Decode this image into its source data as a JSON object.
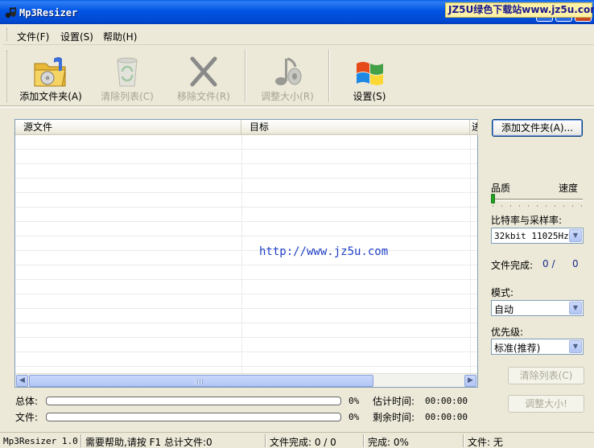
{
  "window": {
    "title": "Mp3Resizer",
    "watermark": "JZ5U绿色下载站www.jz5u.com"
  },
  "menu": [
    {
      "label": "文件(F)"
    },
    {
      "label": "设置(S)"
    },
    {
      "label": "帮助(H)"
    }
  ],
  "toolbar": {
    "add_folder": {
      "label": "添加文件夹(A)",
      "icon": "folder-music-icon",
      "enabled": true
    },
    "clear_list": {
      "label": "清除列表(C)",
      "icon": "recycle-bin-icon",
      "enabled": false
    },
    "remove_file": {
      "label": "移除文件(R)",
      "icon": "x-remove-icon",
      "enabled": false
    },
    "resize": {
      "label": "调整大小(R)",
      "icon": "music-note-icon",
      "enabled": false
    },
    "settings": {
      "label": "设置(S)",
      "icon": "windows-logo-icon",
      "enabled": true
    }
  },
  "file_list": {
    "columns": [
      "源文件",
      "目标",
      "进"
    ],
    "rows": [],
    "center_text": "http://www.jz5u.com"
  },
  "side": {
    "add_folder_button": "添加文件夹(A)...",
    "quality_label": "品质",
    "speed_label": "速度",
    "quality_speed_level": 0,
    "bitrate_label": "比特率与采样率:",
    "bitrate_value": "32kbit 11025Hz",
    "files_done_label": "文件完成:",
    "files_done_value": "0 /",
    "files_done_total": "0",
    "mode_label": "模式:",
    "mode_value": "自动",
    "priority_label": "优先级:",
    "priority_value": "标准(推荐)",
    "clear_list_button": "清除列表(C)",
    "resize_button": "调整大小!"
  },
  "progress": {
    "total": {
      "label": "总体:",
      "percent": 0,
      "percent_text": "0%",
      "time_label": "估计时间:",
      "time_value": "00:00:00"
    },
    "file": {
      "label": "文件:",
      "percent": 0,
      "percent_text": "0%",
      "time_label": "剩余时间:",
      "time_value": "00:00:00"
    }
  },
  "statusbar": {
    "app_version": "Mp3Resizer 1.0",
    "help_text": "需要帮助,请按 F1 总计文件:0",
    "files_done": "文件完成: 0 /   0",
    "completion": "完成: 0%",
    "current_file": "文件: 无"
  },
  "colors": {
    "title_bar": "#0054e3",
    "window_bg": "#ece9d8",
    "progress_fill": "#2bc12b",
    "link_text": "#1e3ec7"
  }
}
